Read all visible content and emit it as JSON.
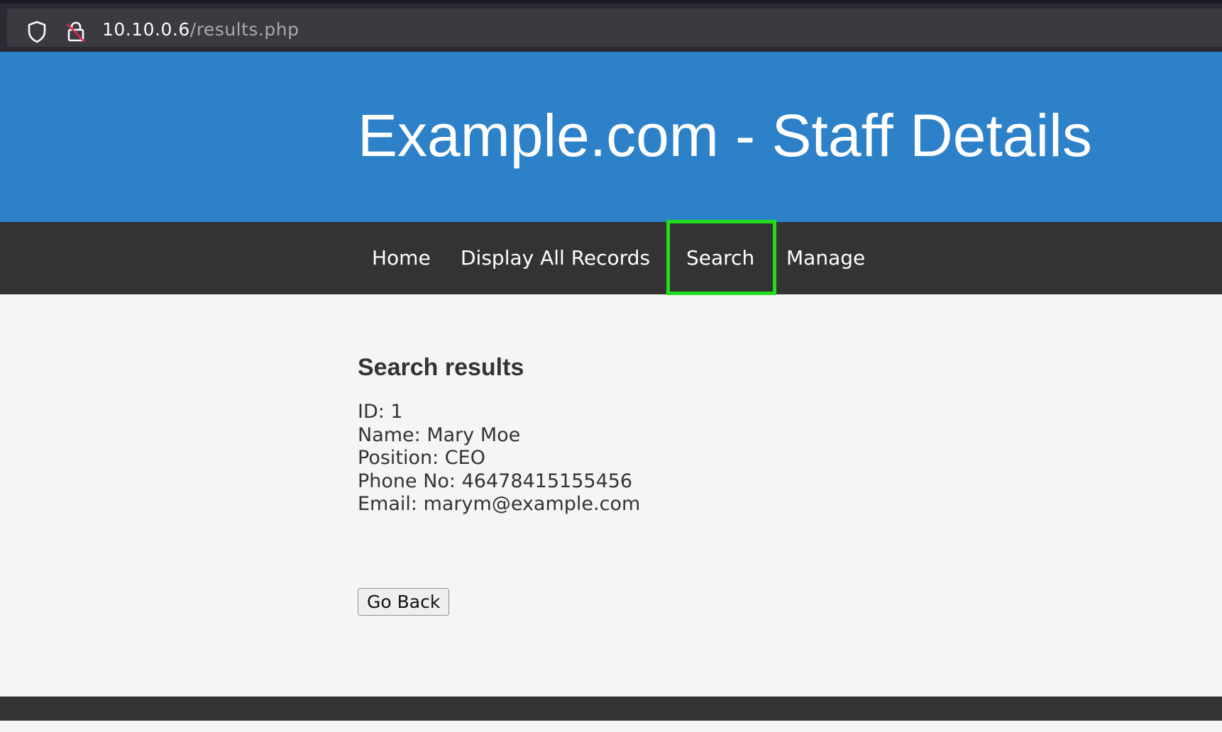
{
  "browser": {
    "url_host": "10.10.0.6",
    "url_path": "/results.php",
    "icons": [
      "shield-icon",
      "lock-insecure-icon"
    ]
  },
  "header": {
    "title": "Example.com - Staff Details"
  },
  "nav": {
    "items": [
      {
        "label": "Home"
      },
      {
        "label": "Display All Records"
      },
      {
        "label": "Search"
      },
      {
        "label": "Manage"
      }
    ],
    "highlighted": "Search",
    "highlight_color": "#22dd1c"
  },
  "main": {
    "heading": "Search results",
    "record": {
      "id": "ID: 1",
      "name": "Name: Mary Moe",
      "position": "Position: CEO",
      "phone": "Phone No: 46478415155456",
      "email": "Email: marym@example.com"
    },
    "go_back_label": "Go Back"
  },
  "colors": {
    "header_bg": "#2d81c8",
    "nav_bg": "#333333",
    "page_bg": "#f5f5f5"
  }
}
